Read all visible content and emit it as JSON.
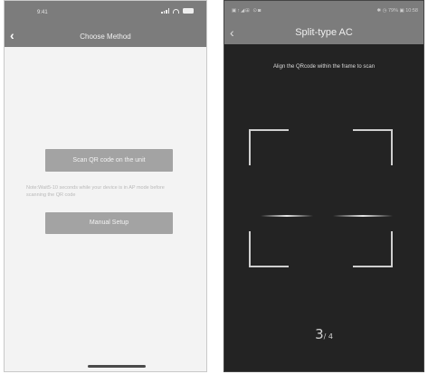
{
  "left_screen": {
    "status": {
      "time": "9:41"
    },
    "nav": {
      "back_glyph": "‹",
      "title": "Choose Method"
    },
    "scan_button": "Scan QR code on the unit",
    "note": "Note:Wait5-10 seconds while your device is in AP mode before scanning the QR code",
    "manual_button": "Manual Setup"
  },
  "right_screen": {
    "status": {
      "left_icons": "▣↑◢⊞ ⊙◙",
      "right_info": "✱ ◷ 79% ▣ 10:58"
    },
    "nav": {
      "back_glyph": "‹",
      "title": "Split-type AC"
    },
    "hint": "Align the QRcode within the frame to scan",
    "counter": {
      "main": "3",
      "sub": "/ 4"
    }
  },
  "colors": {
    "nav_bar": "#7c7c7c",
    "button": "#a3a3a3",
    "left_background": "#f3f3f3",
    "scanner_background": "#232323"
  }
}
